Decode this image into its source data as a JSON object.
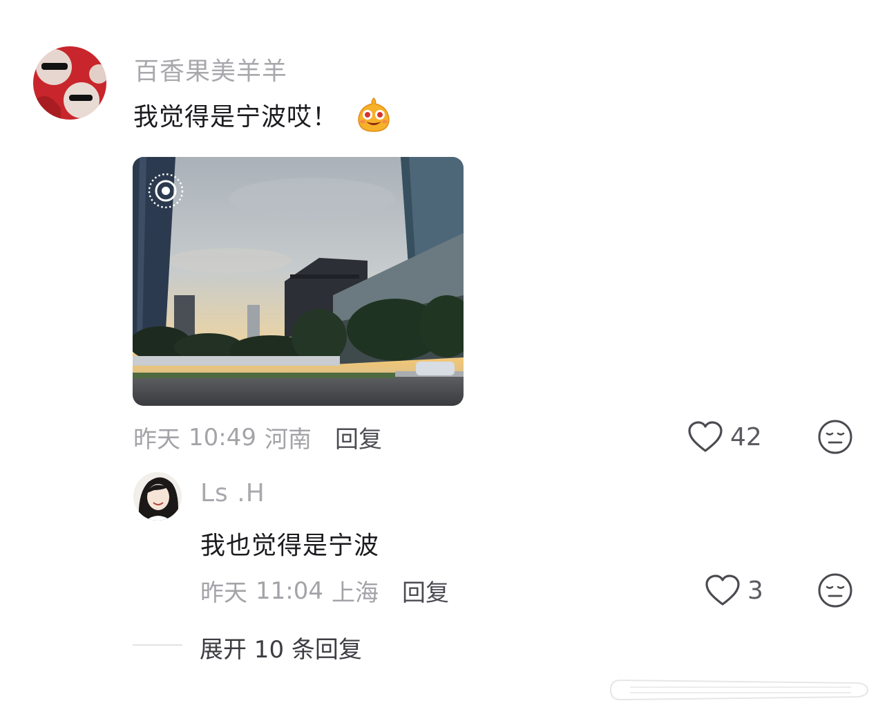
{
  "comment": {
    "username": "百香果美羊羊",
    "text": "我觉得是宁波哎！",
    "emoji": "happy-face-emoji",
    "date": "昨天",
    "time": "10:49",
    "location": "河南",
    "reply_label": "回复",
    "like_count": "42"
  },
  "reply": {
    "username": "Ls .H",
    "text": "我也觉得是宁波",
    "date": "昨天",
    "time": "11:04",
    "location": "上海",
    "reply_label": "回复",
    "like_count": "3"
  },
  "expand": {
    "label": "展开 10 条回复"
  },
  "icons": {
    "like": "heart-outline-icon",
    "dislike": "neutral-face-icon",
    "live_photo": "live-photo-icon"
  },
  "colors": {
    "username": "#a8a8ad",
    "text": "#1b1b1f",
    "meta": "#a3a3a8"
  }
}
